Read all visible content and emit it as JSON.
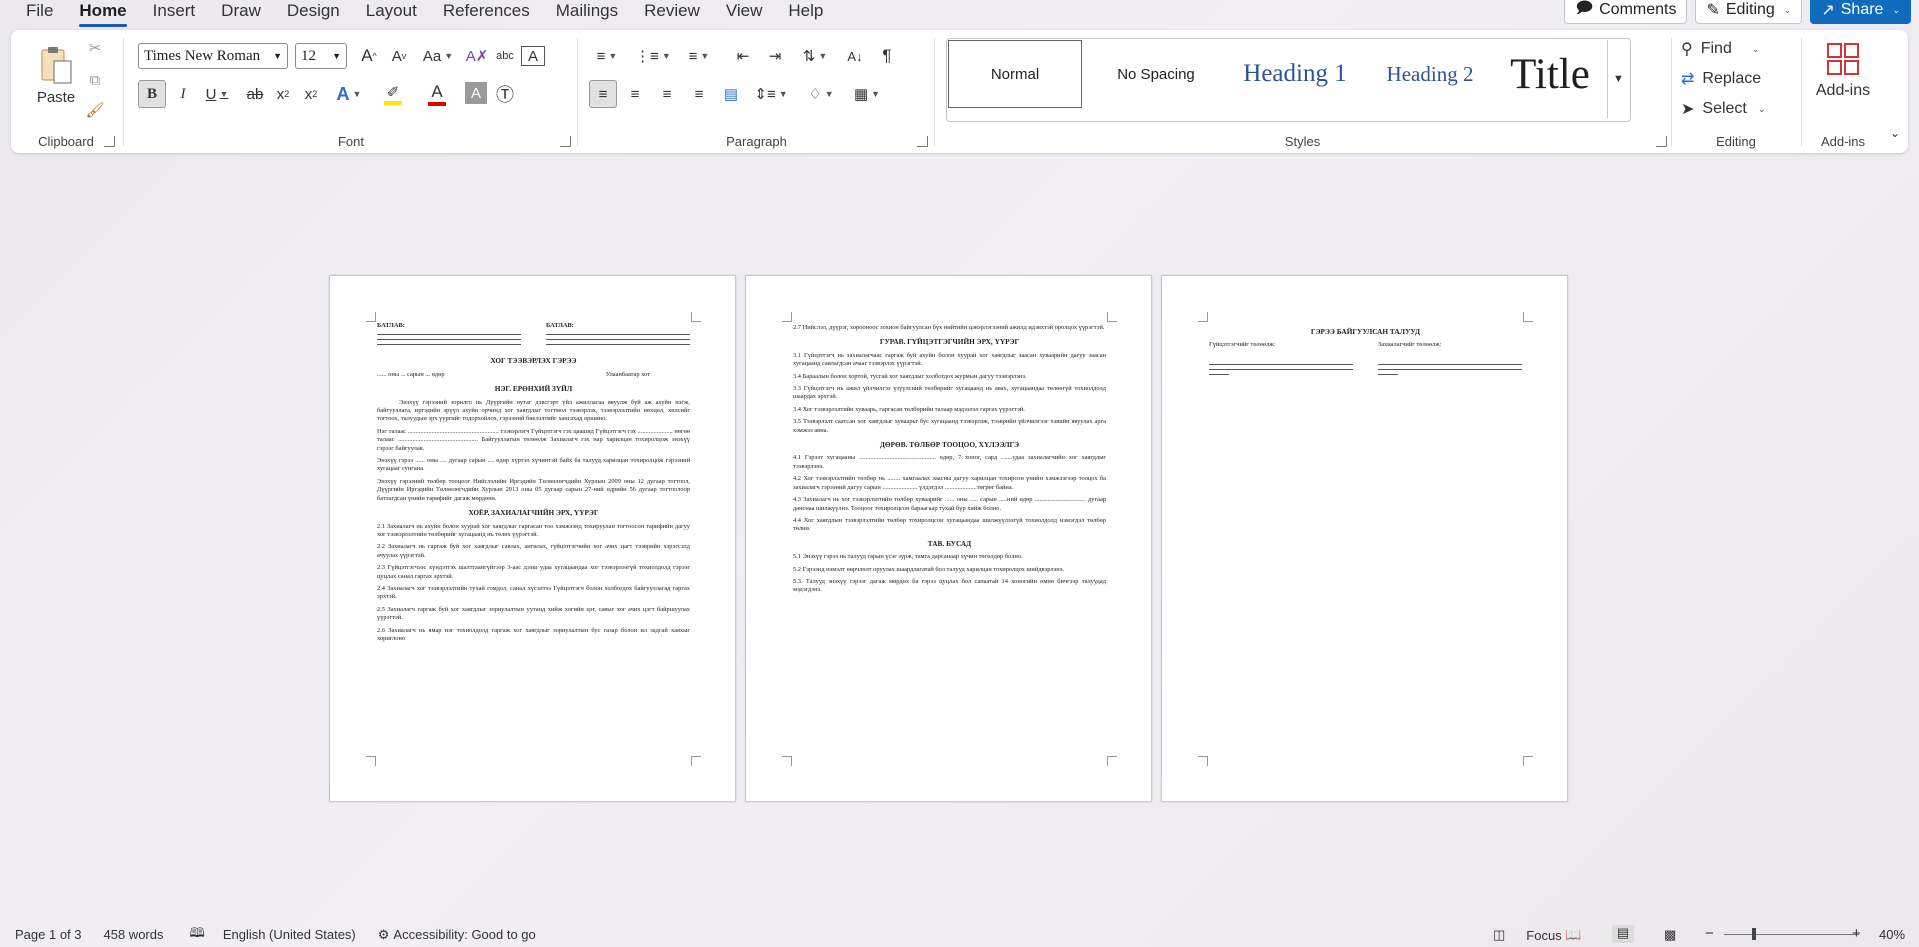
{
  "menu": {
    "tabs": [
      "File",
      "Home",
      "Insert",
      "Draw",
      "Design",
      "Layout",
      "References",
      "Mailings",
      "Review",
      "View",
      "Help"
    ],
    "active": "Home",
    "comments": "Comments",
    "editing": "Editing",
    "share": "Share"
  },
  "ribbon": {
    "clipboard": {
      "label": "Clipboard",
      "paste": "Paste"
    },
    "font": {
      "label": "Font",
      "name": "Times New Roman",
      "size": "12"
    },
    "paragraph": {
      "label": "Paragraph"
    },
    "styles": {
      "label": "Styles",
      "normal": "Normal",
      "no_spacing": "No Spacing",
      "heading1": "Heading 1",
      "heading2": "Heading 2",
      "title": "Title"
    },
    "editing": {
      "label": "Editing",
      "find": "Find",
      "replace": "Replace",
      "select": "Select"
    },
    "addins": {
      "label": "Add-ins",
      "button": "Add-ins"
    }
  },
  "colors": {
    "accent": "#185abd",
    "share": "#0f6cbd",
    "highlight": "#ffe600",
    "font_color": "#e00000",
    "heading": "#2f5496"
  },
  "doc": {
    "p1": {
      "approve": "БАТЛАВ:",
      "title": "ХОГ ТЭЭВЭРЛЭХ ГЭРЭЭ",
      "date_line": "...... оны ... сарын ... өдөр",
      "city": "Улаанбаатар хот",
      "s1": "НЭГ. ЕРӨНХИЙ ЗҮЙЛ",
      "s1p1": "Энэхүү гэрээний зорилго нь Дүүргийн нутаг дэвсгэрт үйл ажиллагаа явуулж буй аж ахуйн нэгж, байгууллага, иргэдийн эрүүл ахуйн орчинд хог хаягдлыг тогтмол тээвэрлэх, тээвэрлэлтийн нөхцөл, хөлсийг тогтоох, талуудын эрх үүргийг тодорхойлох, гэрээний биелэлтийг хангахад оршино.",
      "s1p2": "Нэг талаас ......................................................... тээвэрлэгч Гүйцэтгэгч гэх цаашид Гүйцэтгэгч гэх ...................... нөгөө талаас .................................................. Байгууллагын төлөөлж Захиалагч гэх нар харилцан тохиролцож энэхүү гэрээг байгуулав.",
      "s1p3": "Энэхүү гэрээ ...... оны .... дугаар сарын .... өдөр хүртэл хүчинтэй байх ба талууд харилцан тохиролцож гэрээний хугацааг сунгана.",
      "s1p4": "Энэхүү гэрээний төлбөр тооцоог Нийслэлийн Иргэдийн Төлөөлөгчдийн Хурлын 2009 оны 12 дугаар тогтоол, Дүүргийн Иргэдийн Төлөөлөгчдийн Хурлын 2013 оны 05 дугаар сарын 27-ний өдрийн 56 дугаар тогтоолоор батлагдсан үнийн тарифийг дагаж мөрдөнө.",
      "s2": "ХОЁР. ЗАХИАЛАГЧИЙН ЭРХ, ҮҮРЭГ",
      "s2p1": "2.1 Захиалагч нь ахуйн болон хуурай хог хаягдлыг гаргасан тоо хэмжээнд тохируулан тогтоосон тарифийн дагуу хог тээвэрлэлтийн төлбөрийг хугацаанд нь төлөх үүрэгтэй.",
      "s2p2": "2.2 Захиалагч нь гаргаж буй хог хаягдлыг савлах, ангилах, гүйцэтгэгчийн хог ачих цагт тээврийн хэрэгсэлд ачуулах үүрэгтэй.",
      "s2p3": "2.3 Гүйцэтгэгчээс хүндэтгэх шалтгаангүйгээр 3-аас дээш удаа хугацаандаа хог тээвэрлээгүй тохиолдолд гэрээг цуцлах санал гаргах эрхтэй.",
      "s2p4": "2.4 Захиалагч хог тээвэрлэлтийн тухай гомдол, санал хүсэлтээ Гүйцэтгэгч болон холбогдох байгууллагад гаргах эрхтэй.",
      "s2p5": "2.5 Захиалагч гаргаж буй хог хаягдлыг зориулалтын уутанд хийж хогийн цэг, савыг хог ачих цэгт байршуулах үүрэгтэй.",
      "s2p6": "2.6 Захиалагч нь ямар нэг тохиолдолд гаргаж хог хаягдлыг зориулалтын бус газар болон ил задгай хаяхыг хориглоно"
    },
    "p2": {
      "p27": "2.7 Нийслэл, дүүрэг, хорооноос зохион байгуулсан бүх нийтийн цэвэрлэгээний ажилд идэвхтэй оролцох үүрэгтэй.",
      "s3": "ГУРАВ. ГҮЙЦЭТГЭГЧИЙН ЭРХ, ҮҮРЭГ",
      "s3p1": "3.1 Гүйцэтгэгч нь захиалагчаас гаргаж буй ахуйн болон хуурай хог хаягдлыг заасан хуваарийн дагуу заасан хугацаанд савлагдсан ачааг тээвэрлэх үүрэгтэй.",
      "s3p2": "3.4 Бараалын болон хортой, тусгай хог хаягдлыг холбогдох журмын дагуу тээвэрлэнэ.",
      "s3p3": "3.3 Гүйцэтгэгч нь ажил үйлчилгээ үзүүлсний төлбөрийг хугацаанд нь авах, хугацаандаа төлөөгүй тохиолдолд шаардах эрхтэй.",
      "s3p4": "3.4 Хог тээвэрлэлтийн хуваарь, гаргасан төлбөрийн талаар мэдээлэл гаргах үүрэгтэй.",
      "s3p5": "3.5 Тээвэрлэлт саатсан хог хаягдлыг хуваарьт бус хугацаанд тээвэрлэж, тээврийн үйлчилгээг хэвийн явуулах арга хэмжээ авна.",
      "s4": "ДӨРӨВ. ТӨЛБӨР ТООЦОО, ХҮЛЭЭЛГЭ",
      "s4p1": "4.1 Гэрээт хугацааны ................................................ өдөр, 7 хоног, сард .......удаа захиалагчийн хог хаягдлыг тээвэрлэнэ.",
      "s4p2": "4.2 Хог тээвэрлэлтийн төлбөр нь ........ хамгаалах заасны дагуу харилцан тохирсон үнийн хэмжээгээр тооцох ба захиалагч гэрээний дагуу сарын ...................... үлдэгдэл ....................төгрөг байна.",
      "s4p3": "4.3 Захиалагч нь хог тээвэрлэлтийн төлбөр хуваарийг ...... оны ..... сарын .....ний өдөр ................................ дугаар данснаа шилжүүлнэ. Тооцоог тохиролцсон бараагаар тухай бүр хийж болно.",
      "s4p4": "4.4 Хог хаягдлын тээвэрлэлтийн төлбөр тохиролцсон хугацаандаа шилжүүлээгүй тохиолдолд нэмэгдэл төлбөр төлнө.",
      "s5": "ТАВ. БУСАД",
      "s5p1": "5.1 Энэхүү гэрээ нь талууд гарын үсэг зурж, тамга дарсанаар хүчин төгөлдөр болно.",
      "s5p2": "5.2 Гэрээнд нэмэлт өөрчлөлт оруулах шаардлагатай бол талууд харилцан тохиролцох шийдвэрлэнэ.",
      "s5p3": "5.3. Талууд энэхүү гэрээг дагаж мөрдөх ба гэрээ цуцлах бол санаатай 14 хоногийн өмнө бичгээр талуудад мэдэгдэнэ."
    },
    "p3": {
      "title": "ГЭРЭЭ БАЙГУУЛСАН ТАЛУУД",
      "contractor": "Гүйцэтгэгчийг төлөөлж:",
      "client": "Захиалагчийг төлөөлж:"
    }
  },
  "status": {
    "page": "Page 1 of 3",
    "words": "458 words",
    "language": "English (United States)",
    "accessibility": "Accessibility: Good to go",
    "focus": "Focus",
    "zoom": "40%"
  }
}
